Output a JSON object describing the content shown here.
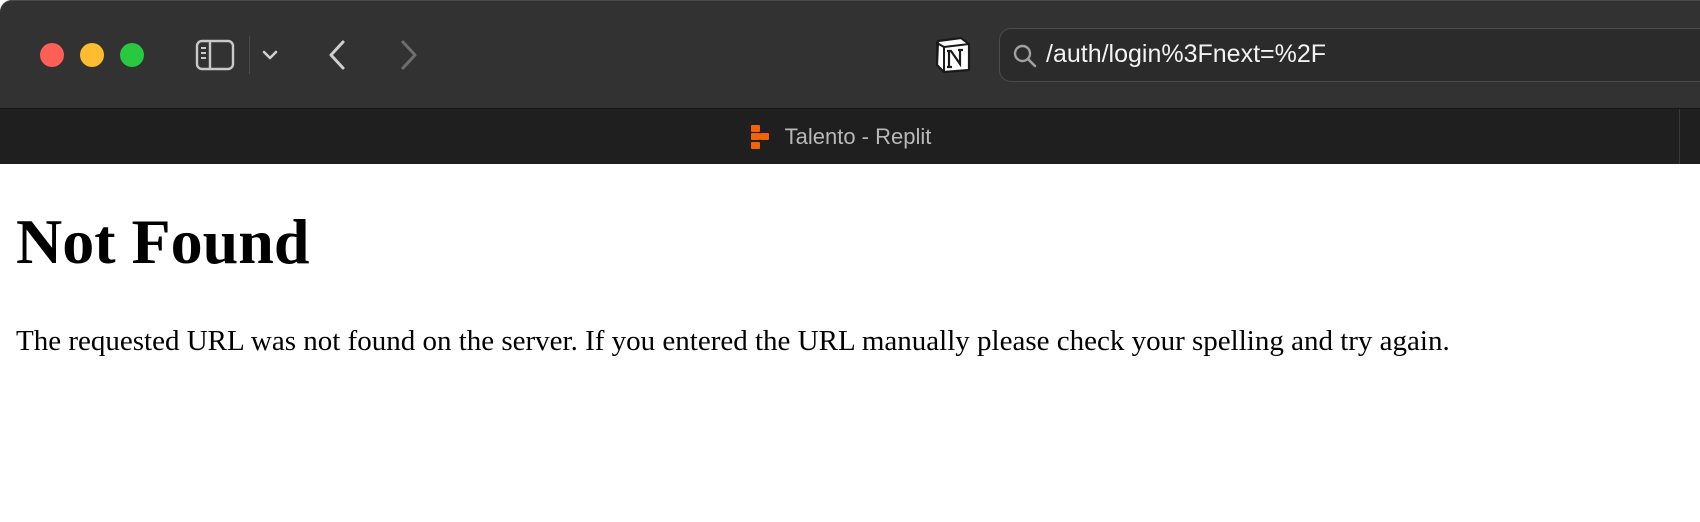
{
  "browser": {
    "address_bar": {
      "url": "/auth/login%3Fnext=%2F",
      "search_icon": "magnifier-icon"
    },
    "toolbar_icons": {
      "sidebar": "sidebar-icon",
      "tab_overview": "chevron-down-icon",
      "back": "chevron-left-icon",
      "forward": "chevron-right-icon",
      "extension": "notion-icon"
    },
    "tabs": [
      {
        "title": "Talento - Replit",
        "favicon": "replit-icon",
        "active": true
      }
    ],
    "colors": {
      "close": "#ff5f57",
      "minimize": "#febc2e",
      "maximize": "#28c840",
      "favicon": "#f26207"
    }
  },
  "page": {
    "heading": "Not Found",
    "message": "The requested URL was not found on the server. If you entered the URL manually please check your spelling and try again."
  }
}
